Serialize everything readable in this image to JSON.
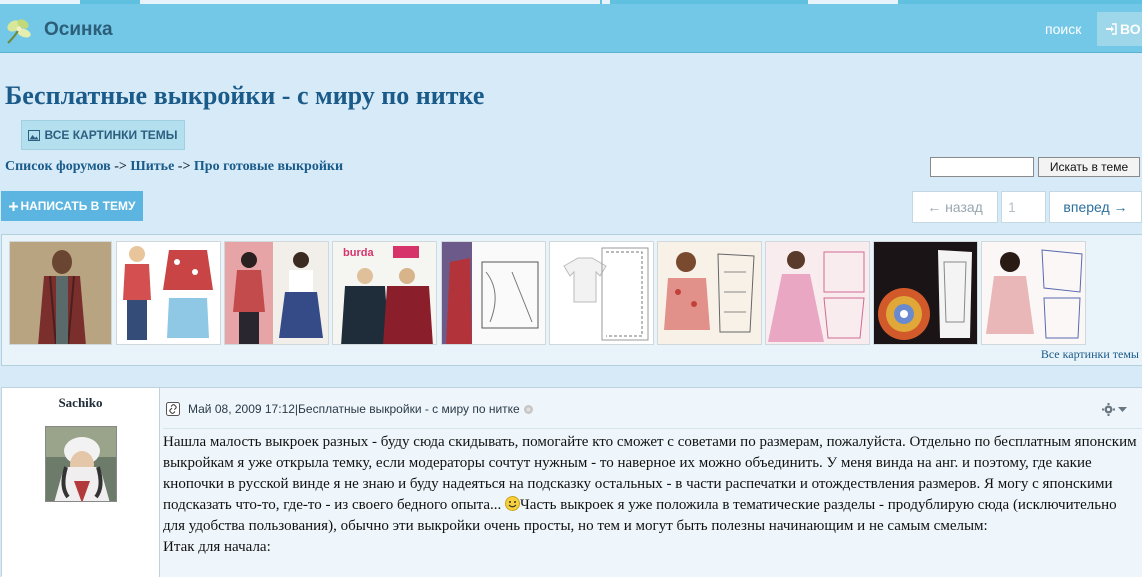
{
  "colors": {
    "navbar": "#72c8e6",
    "title": "#1a5b8a",
    "reply_button": "#5cb5e0",
    "page_bg": "#d6eaf8"
  },
  "navbar": {
    "brand": "Осинка",
    "brand_icon": "flower-logo-icon",
    "search_link": "поиск",
    "login_button": "ВО"
  },
  "topic": {
    "title": "Бесплатные выкройки - с миру по нитке",
    "all_images_button": "ВСЕ КАРТИНКИ ТЕМЫ",
    "breadcrumb": {
      "forums": "Список форумов",
      "sep1": " -> ",
      "section": "Шитье",
      "sep2": " -> ",
      "subsection": "Про готовые выкройки"
    },
    "search_button": "Искать в теме",
    "search_value": "",
    "reply_button": "НАПИСАТЬ В ТЕМУ",
    "pagination": {
      "prev": "← назад",
      "page_placeholder": "1",
      "next": "вперед →"
    }
  },
  "gallery": {
    "thumbnails": [
      "coat-thumb",
      "kids-shirts-thumb",
      "fashion-thumb",
      "burda-hoodie-thumb",
      "pattern-draft-thumb",
      "tshirt-pattern-thumb",
      "blouse-pattern-thumb",
      "pink-dress-thumb",
      "mandala-top-thumb",
      "pink-dress2-thumb"
    ],
    "all_images_link": "Все картинки темы"
  },
  "post": {
    "author": "Sachiko",
    "date": "Май 08, 2009 17:12",
    "separator": " | ",
    "subject": "Бесплатные выкройки - с миру по нитке",
    "body_part1": "Нашла малость выкроек разных - буду сюда скидывать, помогайте кто сможет с советами по размерам, пожалуйста. Отдельно по бесплатным японским выкройкам я уже открыла темку, если модераторы сочтут нужным - то наверное их можно объединить. У меня винда на анг. и поэтому, где какие кнопочки в русской винде я не знаю и буду надеяться на подсказку остальных - в части распечатки и отождествления размеров. Я могу с японскими подсказать что-то, где-то - из своего бедного опыта... ",
    "body_part2": "Часть выкроек я уже положила в тематические разделы - продублирую сюда (исключительно для удобства пользования), обычно эти выкройки очень просты, но тем и могут быть полезны начинающим и не самым смелым:",
    "body_line3": "Итак для начала:"
  }
}
